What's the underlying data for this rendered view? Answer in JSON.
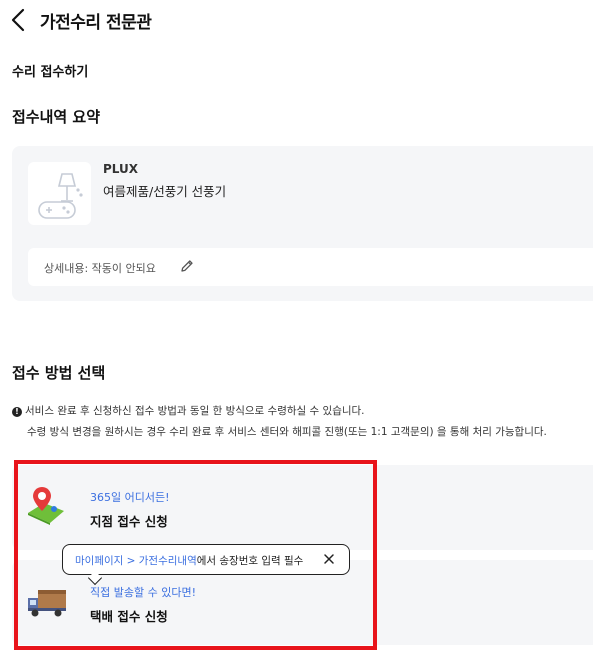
{
  "header": {
    "title": "가전수리 전문관",
    "back_icon": "chevron-left-icon"
  },
  "page": {
    "section_title": "수리 접수하기",
    "summary_heading": "접수내역 요약"
  },
  "summary": {
    "product_brand": "PLUX",
    "product_name": "여름제품/선풍기 선풍기",
    "thumbnail_icon": "product-placeholder-icon",
    "detail_text": "상세내용: 작동이 안되요",
    "edit_icon": "pencil-icon"
  },
  "method": {
    "heading": "접수 방법 선택",
    "notice_line1": "서비스 완료 후 신청하신 접수 방법과 동일 한 방식으로 수령하실 수 있습니다.",
    "notice_line2": "수령 방식 변경을 원하시는 경우 수리 완료 후 서비스 센터와 해피콜 진행(또는 1:1 고객문의) 을 통해 처리 가능합니다.",
    "notice_icon": "info-icon",
    "options": [
      {
        "sub": "365일 어디서든!",
        "title": "지점 접수 신청",
        "icon": "map-pin-icon"
      },
      {
        "sub": "직접 발송할 수 있다면!",
        "title": "택배 접수 신청",
        "icon": "delivery-truck-icon"
      }
    ]
  },
  "tooltip": {
    "link_text": "마이페이지 > 가전수리내역",
    "rest_text": "에서 송장번호 입력 필수",
    "close_icon": "close-icon"
  },
  "colors": {
    "accent_blue": "#3b6fe0",
    "highlight_red": "#e8141b",
    "card_bg": "#f5f6f8"
  }
}
